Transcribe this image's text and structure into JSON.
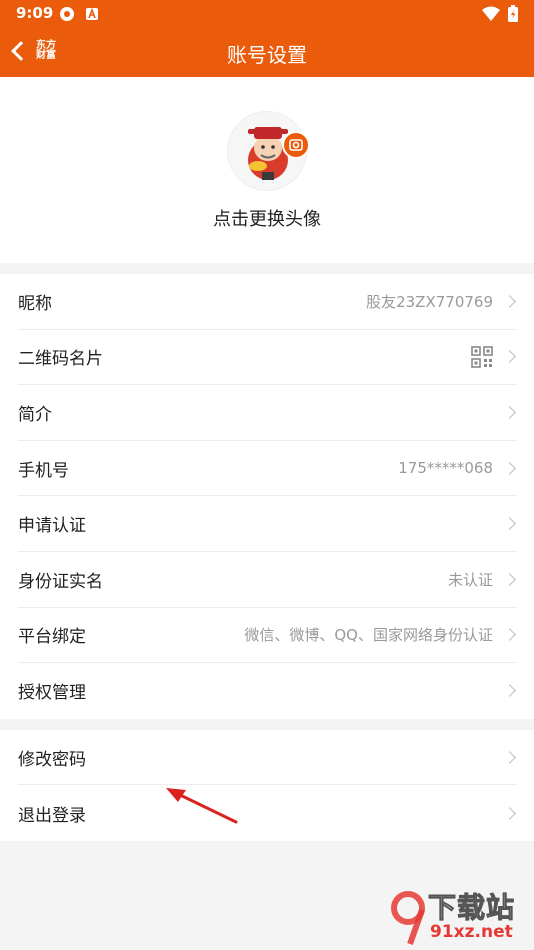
{
  "status_bar": {
    "time": "9:09"
  },
  "header": {
    "title": "账号设置",
    "logo_line1": "东方",
    "logo_line2": "财富"
  },
  "avatar": {
    "tip": "点击更换头像"
  },
  "settings": [
    {
      "label": "昵称",
      "value": "股友23ZX770769"
    },
    {
      "label": "二维码名片",
      "value": ""
    },
    {
      "label": "简介",
      "value": ""
    },
    {
      "label": "手机号",
      "value": "175*****068"
    },
    {
      "label": "申请认证",
      "value": ""
    },
    {
      "label": "身份证实名",
      "value": "未认证"
    },
    {
      "label": "平台绑定",
      "value": "微信、微博、QQ、国家网络身份认证"
    },
    {
      "label": "授权管理",
      "value": ""
    }
  ],
  "account": [
    {
      "label": "修改密码"
    },
    {
      "label": "退出登录"
    }
  ],
  "watermark": {
    "text1": "下载站",
    "text2": "91xz.net"
  },
  "colors": {
    "brand": "#ea5b0c",
    "annotation_arrow": "#d9231f"
  }
}
